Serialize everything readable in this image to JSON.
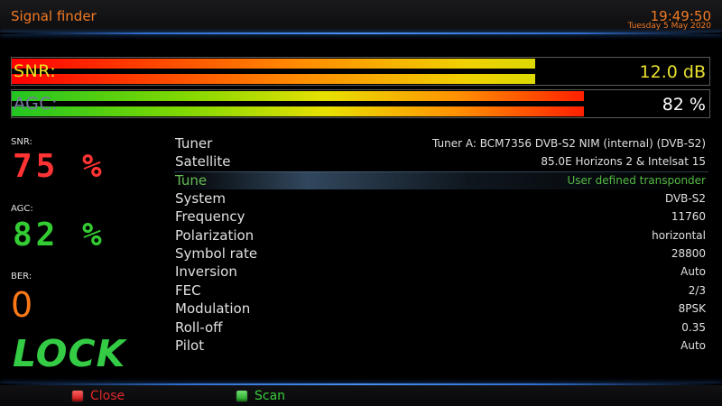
{
  "header": {
    "title": "Signal finder",
    "time": "19:49:50",
    "date": "Tuesday  5 May 2020"
  },
  "bars": {
    "snr": {
      "label": "SNR:",
      "value": "12.0 dB",
      "fill_fraction": 0.75
    },
    "agc": {
      "label": "AGC:",
      "value": "82 %",
      "fill_fraction": 0.82
    }
  },
  "left": {
    "snr_label": "SNR:",
    "snr_value": "75 %",
    "agc_label": "AGC:",
    "agc_value": "82 %",
    "ber_label": "BER:",
    "ber_value": "0",
    "lock": "LOCK"
  },
  "info": [
    {
      "key": "Tuner",
      "value": "Tuner A: BCM7356 DVB-S2 NIM (internal) (DVB-S2)"
    },
    {
      "key": "Satellite",
      "value": "85.0E Horizons 2 & Intelsat 15"
    },
    {
      "key": "Tune",
      "value": "User defined transponder",
      "selected": true
    },
    {
      "key": "System",
      "value": "DVB-S2"
    },
    {
      "key": "Frequency",
      "value": "11760"
    },
    {
      "key": "Polarization",
      "value": "horizontal"
    },
    {
      "key": "Symbol rate",
      "value": "28800"
    },
    {
      "key": "Inversion",
      "value": "Auto"
    },
    {
      "key": "FEC",
      "value": "2/3"
    },
    {
      "key": "Modulation",
      "value": "8PSK"
    },
    {
      "key": "Roll-off",
      "value": "0.35"
    },
    {
      "key": "Pilot",
      "value": "Auto"
    }
  ],
  "footer": {
    "red_label": "Close",
    "green_label": "Scan"
  },
  "colors": {
    "accent": "#f07a24",
    "snr_text": "#ff3333",
    "agc_text": "#33cc33",
    "selected": "#55bb44",
    "header_line": "#2f6fd0"
  }
}
